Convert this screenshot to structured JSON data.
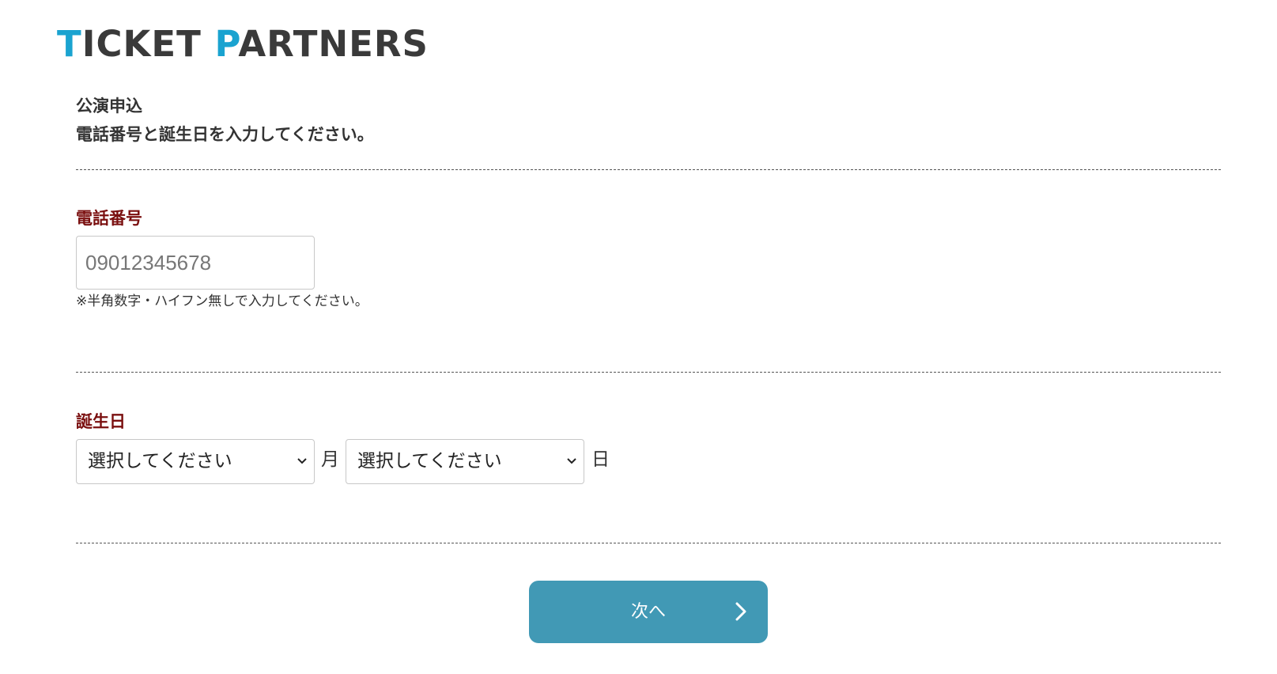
{
  "logo": {
    "first_letter": "T",
    "first_rest": "ICKET",
    "second_letter": "P",
    "second_rest": "ARTNERS"
  },
  "header": {
    "title": "公演申込",
    "instruction": "電話番号と誕生日を入力してください。"
  },
  "phone": {
    "label": "電話番号",
    "placeholder": "09012345678",
    "value": "",
    "note": "※半角数字・ハイフン無しで入力してください。"
  },
  "birthday": {
    "label": "誕生日",
    "month_select": "選択してください",
    "month_unit": "月",
    "day_select": "選択してください",
    "day_unit": "日"
  },
  "next_button": {
    "label": "次へ",
    "icon": "chevron-right-icon"
  },
  "colors": {
    "logo_accent": "#1aa3d0",
    "logo_text": "#3a3a3a",
    "section_label": "#7a0f0f",
    "button": "#4199b5"
  }
}
